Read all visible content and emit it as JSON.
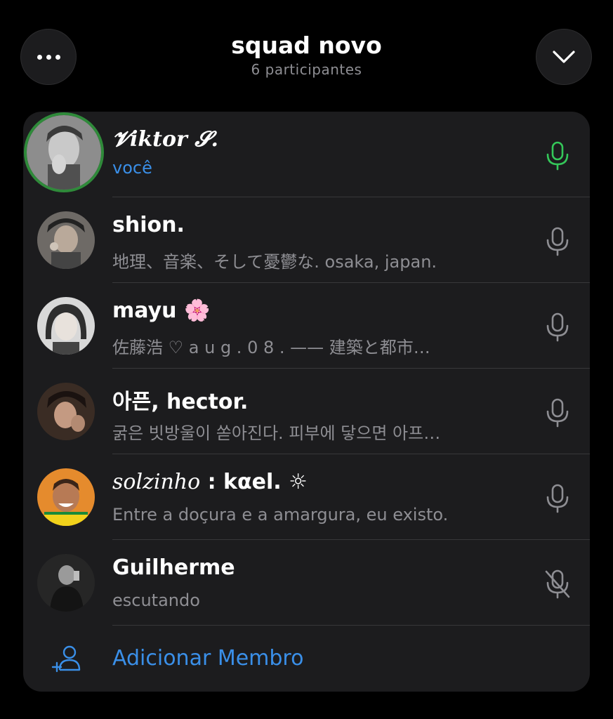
{
  "header": {
    "title": "squad novo",
    "subtitle": "6 participantes",
    "more_icon": "ellipsis-icon",
    "collapse_icon": "chevron-down-icon"
  },
  "members": [
    {
      "name": "𝓥iktor 𝓢.",
      "subtitle": "você",
      "mic": "mic-active",
      "avatar_bg": "#9a9a9a"
    },
    {
      "name": " shion.",
      "subtitle": "地理、音楽、そして憂鬱な. osaka, japan.",
      "mic": "mic",
      "avatar_bg": "#7a7a7a"
    },
    {
      "name": "mayu 🌸",
      "subtitle": "佐藤浩 ♡ a u g . 0 8 . —— 建築と都市…",
      "mic": "mic",
      "avatar_bg": "#b0b0b0"
    },
    {
      "name": "아픈, hector.",
      "subtitle": "굵은 빗방울이 쏟아진다. 피부에 닿으면 아프…",
      "mic": "mic",
      "avatar_bg": "#4a3a30"
    },
    {
      "name_prefix": "solzinho",
      "name": " : kαel. ☼",
      "subtitle": "Entre a doçura e a amargura, eu existo.",
      "mic": "mic",
      "avatar_bg": "#e08a2a"
    },
    {
      "name": "Guilherme",
      "subtitle": "escutando",
      "mic": "mic-muted",
      "avatar_bg": "#2a2a2a"
    }
  ],
  "add_member": {
    "label": "Adicionar Membro",
    "icon": "add-person-icon"
  },
  "colors": {
    "accent_blue": "#3a8fe8",
    "active_green": "#34c759",
    "muted_gray": "#8e8e93",
    "card_bg": "#1c1c1e"
  }
}
